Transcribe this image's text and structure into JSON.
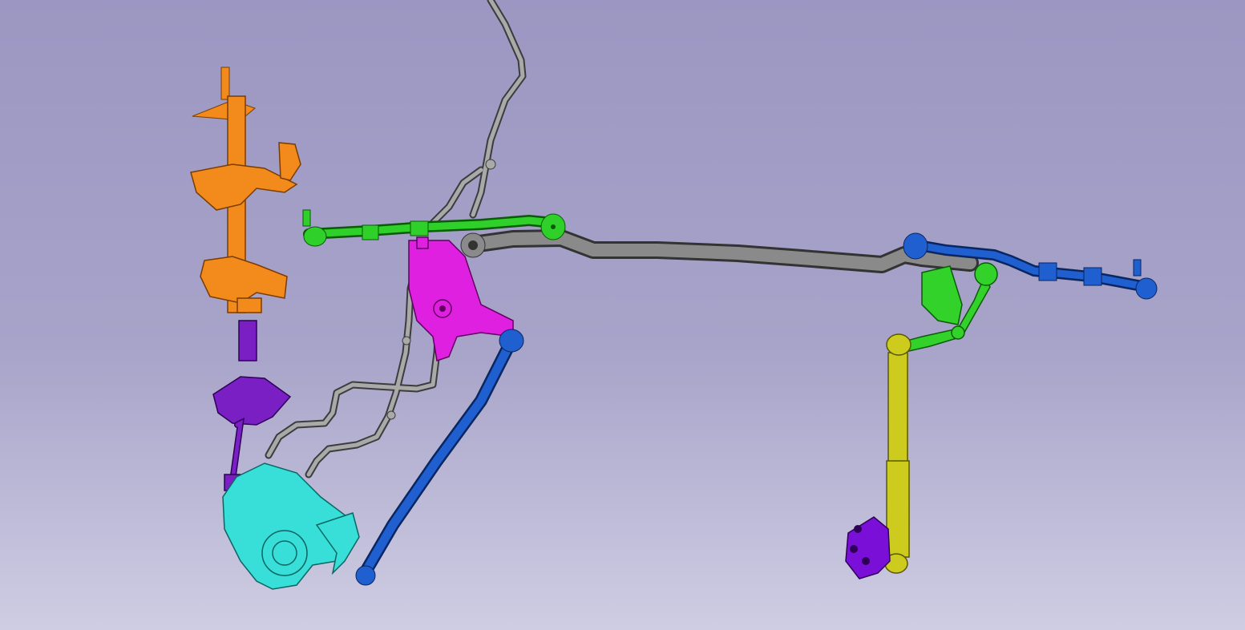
{
  "viewport": {
    "background_top": "#9c97c2",
    "background_mid": "#a7a3c9",
    "background_bottom": "#cfcde3"
  },
  "parts": {
    "steering_column": {
      "color": "#f28a1c",
      "edge": "#7a3c00"
    },
    "intermediate_shaft": {
      "color": "#7a1fc4",
      "edge": "#2e0057"
    },
    "steering_gear": {
      "color": "#38ded8",
      "edge": "#0a6663"
    },
    "pitman_bracket": {
      "color": "#e020e0",
      "edge": "#600060"
    },
    "drag_link": {
      "color": "#1f5fd0",
      "edge": "#0a2660"
    },
    "left_tie_rod": {
      "color": "#2fd02a",
      "edge": "#0a5a08"
    },
    "right_tie_rod": {
      "color": "#1f5fd0",
      "edge": "#0a2660"
    },
    "center_link": {
      "color": "#8a8a8a",
      "edge": "#333333"
    },
    "hydraulic_lines": {
      "color": "#a9a9a9",
      "edge": "#3c3c3c"
    },
    "idler_arm": {
      "color": "#33d22b",
      "edge": "#0a5a08"
    },
    "damper": {
      "color": "#cdcc1e",
      "edge": "#5a5800"
    },
    "damper_mount": {
      "color": "#7a10d8",
      "edge": "#2e0057"
    }
  }
}
